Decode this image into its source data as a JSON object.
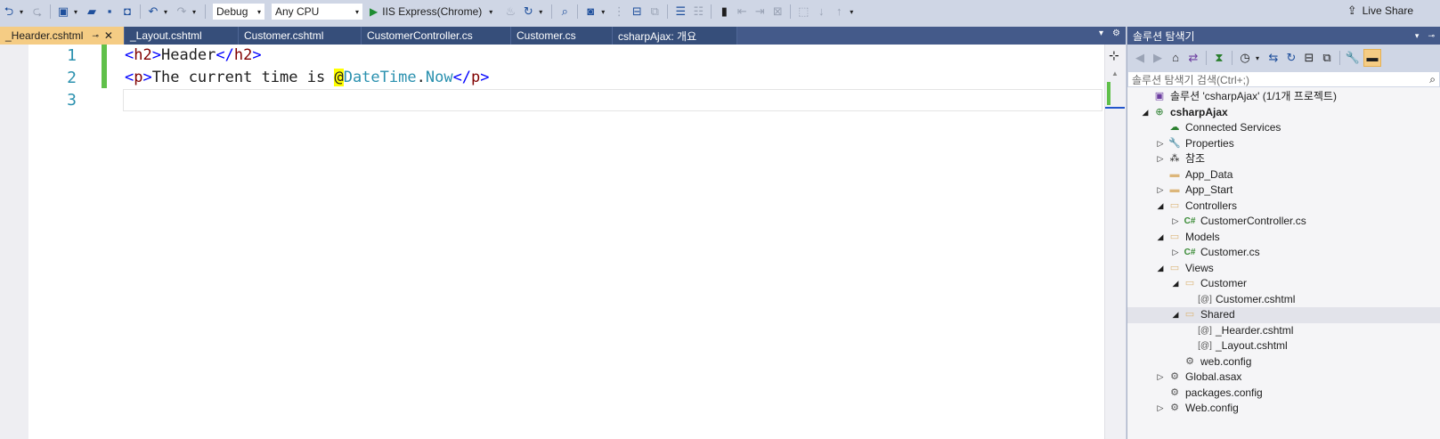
{
  "toolbar": {
    "config": "Debug",
    "platform": "Any CPU",
    "run_target": "IIS Express(Chrome)",
    "live_share": "Live Share"
  },
  "tabs": [
    {
      "label": "_Hearder.cshtml",
      "active": true
    },
    {
      "label": "_Layout.cshtml",
      "active": false
    },
    {
      "label": "Customer.cshtml",
      "active": false
    },
    {
      "label": "CustomerController.cs",
      "active": false
    },
    {
      "label": "Customer.cs",
      "active": false
    },
    {
      "label": "csharpAjax: 개요",
      "active": false
    }
  ],
  "editor": {
    "line_numbers": [
      "1",
      "2",
      "3"
    ],
    "line1": {
      "open_lt": "<",
      "open_tag": "h2",
      "open_gt": ">",
      "text": "Header",
      "close_lt": "</",
      "close_tag": "h2",
      "close_gt": ">"
    },
    "line2": {
      "open_lt": "<",
      "open_tag": "p",
      "open_gt": ">",
      "text": "The current time is ",
      "razor": "@",
      "type": "DateTime",
      "dot": ".",
      "member": "Now",
      "close_lt": "</",
      "close_tag": "p",
      "close_gt": ">"
    }
  },
  "solution_explorer": {
    "title": "솔루션 탐색기",
    "search_placeholder": "솔루션 탐색기 검색(Ctrl+;)",
    "nodes": [
      {
        "label": "솔루션 'csharpAjax' (1/1개 프로젝트)",
        "depth": 0,
        "expander": "",
        "icon": "solution-icon"
      },
      {
        "label": "csharpAjax",
        "depth": 0,
        "expander": "◢",
        "icon": "project-icon",
        "bold": true
      },
      {
        "label": "Connected Services",
        "depth": 1,
        "expander": "",
        "icon": "cloud-icon"
      },
      {
        "label": "Properties",
        "depth": 1,
        "expander": "▷",
        "icon": "wrench-icon"
      },
      {
        "label": "참조",
        "depth": 1,
        "expander": "▷",
        "icon": "references-icon"
      },
      {
        "label": "App_Data",
        "depth": 1,
        "expander": "",
        "icon": "folder-icon"
      },
      {
        "label": "App_Start",
        "depth": 1,
        "expander": "▷",
        "icon": "folder-icon"
      },
      {
        "label": "Controllers",
        "depth": 1,
        "expander": "◢",
        "icon": "folder-open-icon"
      },
      {
        "label": "CustomerController.cs",
        "depth": 2,
        "expander": "▷",
        "icon": "csharp-file-icon"
      },
      {
        "label": "Models",
        "depth": 1,
        "expander": "◢",
        "icon": "folder-open-icon"
      },
      {
        "label": "Customer.cs",
        "depth": 2,
        "expander": "▷",
        "icon": "csharp-file-icon"
      },
      {
        "label": "Views",
        "depth": 1,
        "expander": "◢",
        "icon": "folder-open-icon"
      },
      {
        "label": "Customer",
        "depth": 2,
        "expander": "◢",
        "icon": "folder-open-icon"
      },
      {
        "label": "Customer.cshtml",
        "depth": 3,
        "expander": "",
        "icon": "razor-file-icon"
      },
      {
        "label": "Shared",
        "depth": 2,
        "expander": "◢",
        "icon": "folder-open-icon",
        "selected": true
      },
      {
        "label": "_Hearder.cshtml",
        "depth": 3,
        "expander": "",
        "icon": "razor-file-icon"
      },
      {
        "label": "_Layout.cshtml",
        "depth": 3,
        "expander": "",
        "icon": "razor-file-icon"
      },
      {
        "label": "web.config",
        "depth": 2,
        "expander": "",
        "icon": "config-file-icon"
      },
      {
        "label": "Global.asax",
        "depth": 1,
        "expander": "▷",
        "icon": "config-file-icon"
      },
      {
        "label": "packages.config",
        "depth": 1,
        "expander": "",
        "icon": "config-file-icon"
      },
      {
        "label": "Web.config",
        "depth": 1,
        "expander": "▷",
        "icon": "config-file-icon"
      }
    ]
  },
  "colors": {
    "chrome": "#cfd6e5",
    "tab_bar": "#445a8a",
    "active_tab": "#f5cc84",
    "change_bar": "#60c04a",
    "razor_highlight": "#ffff00"
  }
}
